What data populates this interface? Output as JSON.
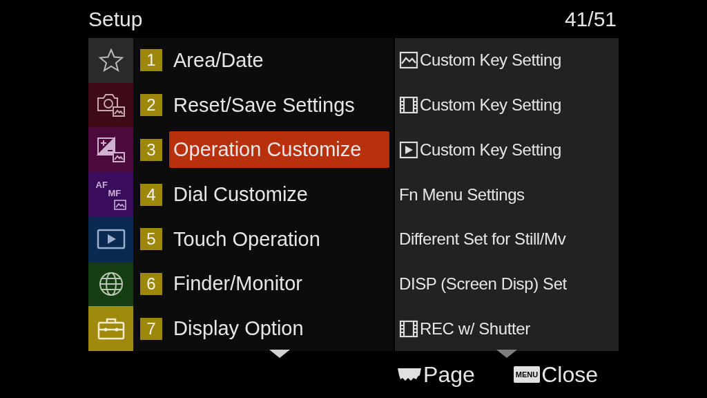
{
  "header": {
    "title": "Setup",
    "page": "41/51"
  },
  "sidebar": [
    {
      "kind": "star",
      "color": "#2a2a2a"
    },
    {
      "kind": "camera",
      "color": "#3e0a16"
    },
    {
      "kind": "exposure",
      "color": "#4c0a3c"
    },
    {
      "kind": "afmf",
      "color": "#3a0c5c",
      "labels": [
        "AF",
        "MF"
      ]
    },
    {
      "kind": "playback",
      "color": "#0a2a52"
    },
    {
      "kind": "globe",
      "color": "#163c12"
    },
    {
      "kind": "toolbox",
      "color": "#a08a0e"
    }
  ],
  "menu": [
    {
      "number": "1",
      "label": "Area/Date",
      "selected": false
    },
    {
      "number": "2",
      "label": "Reset/Save Settings",
      "selected": false
    },
    {
      "number": "3",
      "label": "Operation Customize",
      "selected": true
    },
    {
      "number": "4",
      "label": "Dial Customize",
      "selected": false
    },
    {
      "number": "5",
      "label": "Touch Operation",
      "selected": false
    },
    {
      "number": "6",
      "label": "Finder/Monitor",
      "selected": false
    },
    {
      "number": "7",
      "label": "Display Option",
      "selected": false
    }
  ],
  "submenu": [
    {
      "kind": "photo",
      "label": "Custom Key Setting"
    },
    {
      "kind": "movie",
      "label": "Custom Key Setting"
    },
    {
      "kind": "playback",
      "label": "Custom Key Setting"
    },
    {
      "kind": "plain",
      "label": "Fn Menu Settings"
    },
    {
      "kind": "plain",
      "label": "Different Set for Still/Mv"
    },
    {
      "kind": "plain",
      "label": "DISP (Screen Disp) Set"
    },
    {
      "kind": "movie",
      "label": "REC w/ Shutter"
    }
  ],
  "footer": {
    "page": {
      "label": "Page"
    },
    "close": {
      "key": "MENU",
      "label": "Close"
    }
  }
}
